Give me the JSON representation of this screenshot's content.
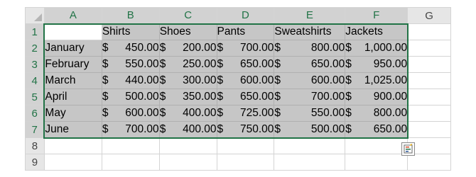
{
  "columns": [
    "A",
    "B",
    "C",
    "D",
    "E",
    "F",
    "G"
  ],
  "rows": [
    "1",
    "2",
    "3",
    "4",
    "5",
    "6",
    "7",
    "8",
    "9"
  ],
  "header_row": [
    "",
    "Shirts",
    "Shoes",
    "Pants",
    "Sweatshirts",
    "Jackets"
  ],
  "data_rows": [
    {
      "month": "January",
      "shirts": "450.00",
      "shoes": "200.00",
      "pants": "700.00",
      "sweatshirts": "800.00",
      "jackets": "1,000.00"
    },
    {
      "month": "February",
      "shirts": "550.00",
      "shoes": "250.00",
      "pants": "650.00",
      "sweatshirts": "650.00",
      "jackets": "950.00"
    },
    {
      "month": "March",
      "shirts": "440.00",
      "shoes": "300.00",
      "pants": "600.00",
      "sweatshirts": "600.00",
      "jackets": "1,025.00"
    },
    {
      "month": "April",
      "shirts": "500.00",
      "shoes": "350.00",
      "pants": "650.00",
      "sweatshirts": "700.00",
      "jackets": "900.00"
    },
    {
      "month": "May",
      "shirts": "600.00",
      "shoes": "400.00",
      "pants": "725.00",
      "sweatshirts": "550.00",
      "jackets": "800.00"
    },
    {
      "month": "June",
      "shirts": "700.00",
      "shoes": "400.00",
      "pants": "750.00",
      "sweatshirts": "500.00",
      "jackets": "650.00"
    }
  ],
  "currency_symbol": "$",
  "selected_columns": [
    "A",
    "B",
    "C",
    "D",
    "E",
    "F"
  ],
  "selected_rows": [
    "1",
    "2",
    "3",
    "4",
    "5",
    "6",
    "7"
  ],
  "selection_color": "#217346",
  "selection_fill": "#c6c6c6",
  "quick_analysis_icon": "quick-analysis-icon"
}
